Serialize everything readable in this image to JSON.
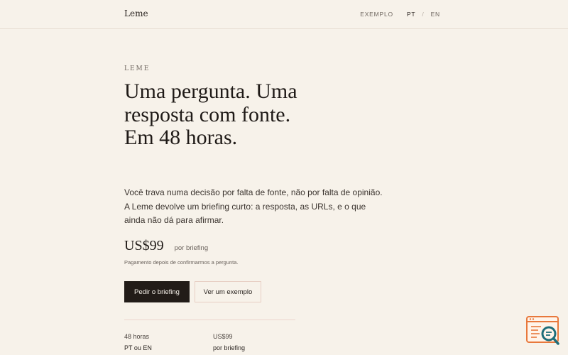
{
  "header": {
    "brand": "Leme",
    "nav": {
      "example": "EXEMPLO",
      "pt": "PT",
      "separator": "/",
      "en": "EN"
    }
  },
  "hero": {
    "eyebrow": "LEME",
    "headline": "Uma pergunta. Uma resposta com fonte. Em 48 horas.",
    "lead": "Você trava numa decisão por falta de fonte, não por falta de opinião. A Leme devolve um briefing curto: a resposta, as URLs, e o que ainda não dá para afirmar."
  },
  "pricing": {
    "amount": "US$99",
    "per": "por briefing",
    "payment_note": "Pagamento depois de confirmarmos a pergunta."
  },
  "actions": {
    "primary": "Pedir o briefing",
    "secondary": "Ver um exemplo"
  },
  "facts": {
    "col1": [
      "48 horas",
      "PT ou EN"
    ],
    "col2": [
      "US$99",
      "por briefing"
    ]
  },
  "colors": {
    "background": "#f7f2ea",
    "text": "#1f1a17",
    "primary_button": "#221c18",
    "accent_border": "#e8cfc4",
    "widget_orange": "#e8783c",
    "widget_teal": "#1f6e7a"
  },
  "icons": {
    "widget": "search-document-icon"
  }
}
